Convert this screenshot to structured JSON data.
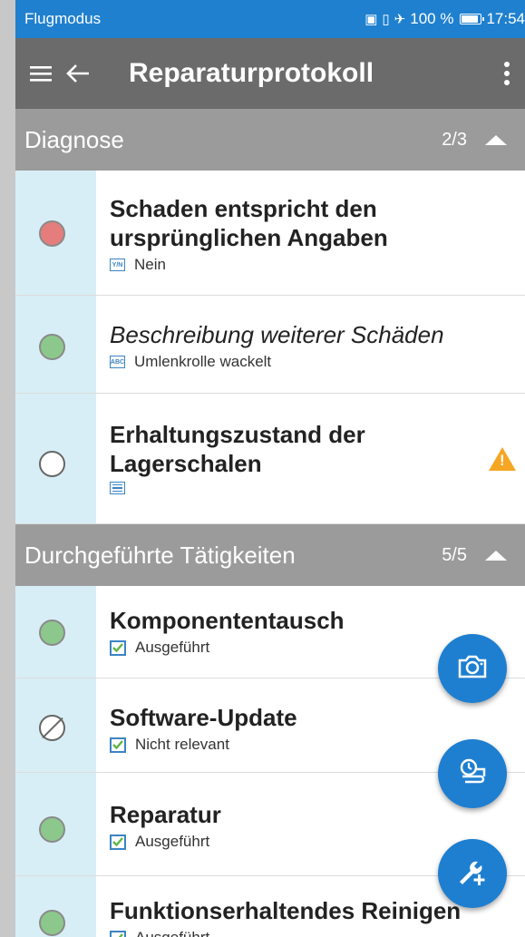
{
  "statusbar": {
    "mode": "Flugmodus",
    "battery_pct": "100 %",
    "time": "17:54",
    "battery_level": 1.0
  },
  "appbar": {
    "title": "Reparaturprotokoll"
  },
  "sections": [
    {
      "title": "Diagnose",
      "count": "2/3"
    },
    {
      "title": "Durchgeführte Tätigkeiten",
      "count": "5/5"
    }
  ],
  "diagnose_items": [
    {
      "label": "Schaden entspricht den ursprünglichen Angaben",
      "type_icon": "Y/N",
      "value": "Nein",
      "status": "red"
    },
    {
      "label": "Beschreibung weiterer Schäden",
      "type_icon": "ABC",
      "value": "Umlenkrolle wackelt",
      "status": "green"
    },
    {
      "label": "Erhaltungszustand der Lagerschalen",
      "type_icon": "list-icon",
      "value": "",
      "status": "empty",
      "warning": true
    }
  ],
  "activity_items": [
    {
      "label": "Komponententausch",
      "value": "Ausgeführt",
      "status": "green"
    },
    {
      "label": "Software-Update",
      "value": "Nicht relevant",
      "status": "not-applicable"
    },
    {
      "label": "Reparatur",
      "value": "Ausgeführt",
      "status": "green"
    },
    {
      "label": "Funktionserhaltendes Reinigen",
      "value": "Ausgeführt",
      "status": "green"
    }
  ],
  "fabs": [
    "camera-icon",
    "time-log-icon",
    "wrench-add-icon"
  ],
  "colors": {
    "primary": "#1e7fd0",
    "appbar": "#6b6b6b",
    "section": "#9b9b9b",
    "strip": "#d8eef6",
    "red": "#e57d7d",
    "green": "#8cc88c",
    "warning": "#f5a623"
  }
}
